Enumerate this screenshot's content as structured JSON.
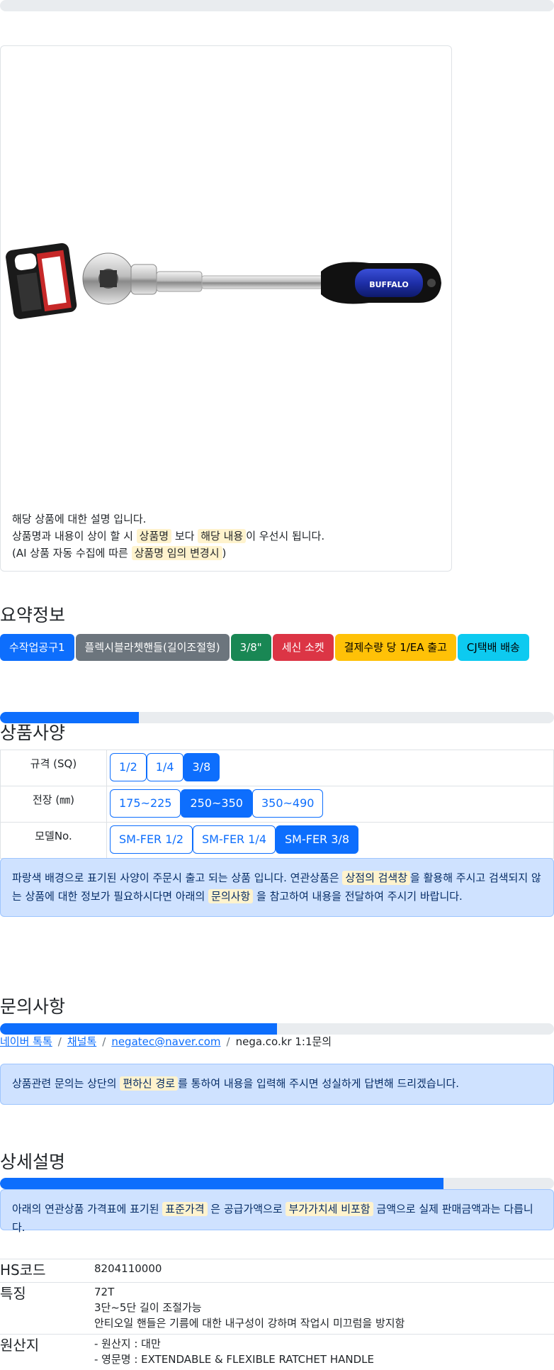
{
  "product_image_alt": "BUFFALO",
  "notice": {
    "line1": "해당 상품에 대한 설명 입니다.",
    "line2_a": "상품명과 내용이 상이 할 시",
    "line2_hl1": "상품명",
    "line2_b": "보다",
    "line2_hl2": "해당 내용",
    "line2_c": "이 우선시 됩니다.",
    "line3_a": "(AI 상품 자동 수집에 따른",
    "line3_hl": "상품명 임의 변경시",
    "line3_b": ")"
  },
  "summary": {
    "title": "요약정보",
    "badges": [
      "수작업공구1",
      "플렉시블라쳇핸들(길이조절형)",
      "3/8\"",
      "세신 소켓",
      "결제수량 당 1/EA 출고",
      "CJ택배 배송"
    ]
  },
  "spec": {
    "progress": 0.25,
    "title": "상품사양",
    "rows": [
      {
        "label": "규격 (SQ)",
        "options": [
          "1/2",
          "1/4",
          "3/8"
        ],
        "selected": 2
      },
      {
        "label": "전장 (㎜)",
        "options": [
          "175~225",
          "250~350",
          "350~490"
        ],
        "selected": 1
      },
      {
        "label": "모델No.",
        "options": [
          "SM-FER 1/2",
          "SM-FER 1/4",
          "SM-FER 3/8"
        ],
        "selected": 2
      }
    ],
    "alert_a": "파랑색 배경으로 표기된 사양이 주문시 출고 되는 상품 입니다. 연관상품은",
    "alert_hl1": "상점의 검색창",
    "alert_b": "을 활용해 주시고 검색되지 않는 상품에 대한 정보가 필요하시다면 아래의",
    "alert_hl2": "문의사항",
    "alert_c": "을 참고하여 내용을 전달하여 주시기 바랍니다."
  },
  "inquiry": {
    "title": "문의사항",
    "progress": 0.5,
    "links": [
      "네이버 톡톡",
      "채널톡",
      "negatec@naver.com"
    ],
    "last": "nega.co.kr 1:1문의",
    "alert_a": "상품관련 문의는 상단의",
    "alert_hl": "편하신 경로",
    "alert_b": "를 통하여 내용을 입력해 주시면 성실하게 답변해 드리겠습니다."
  },
  "detail": {
    "title": "상세설명",
    "progress": 0.8,
    "alert_a": "아래의 연관상품 가격표에 표기된",
    "alert_hl1": "표준가격",
    "alert_b": "은 공급가액으로",
    "alert_hl2": "부가가치세 비포함",
    "alert_c": "금액으로 실제 판매금액과는 다릅니다."
  },
  "info": {
    "hs_key": "HS코드",
    "hs_val": "8204110000",
    "feat_key": "특징",
    "feat_lines": [
      "72T",
      "3단~5단 길이 조절가능",
      "안티오일 핸들은 기름에 대한 내구성이 강하며 작업시 미끄럼을 방지함"
    ],
    "origin_key": "원산지",
    "origin_lines": [
      "- 원산지 : 대만",
      "- 영문명 : EXTENDABLE & FLEXIBLE RATCHET HANDLE"
    ]
  }
}
